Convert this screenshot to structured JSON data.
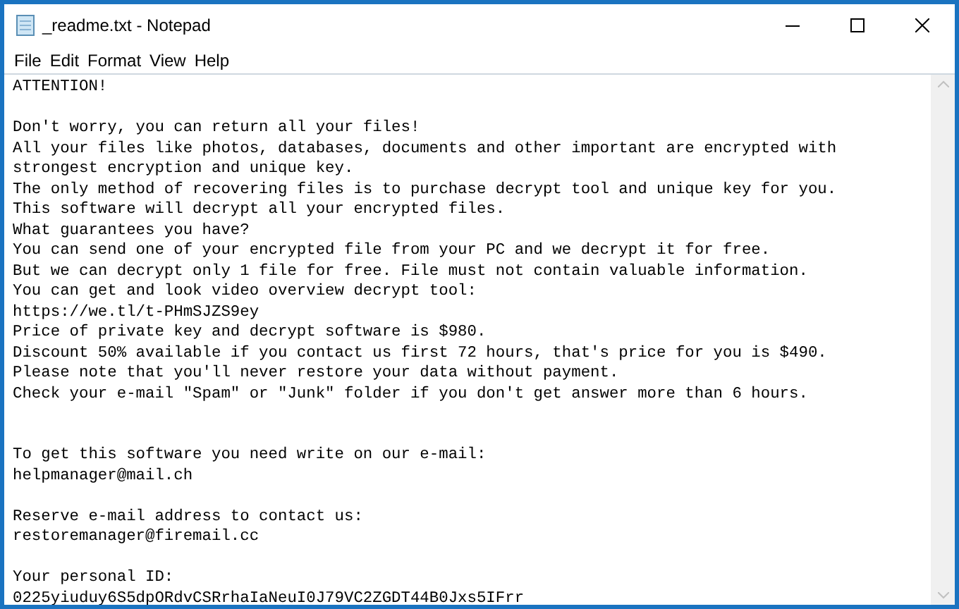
{
  "window": {
    "title": "_readme.txt - Notepad"
  },
  "menu": [
    "File",
    "Edit",
    "Format",
    "View",
    "Help"
  ],
  "document": {
    "text": "ATTENTION!\n\nDon't worry, you can return all your files!\nAll your files like photos, databases, documents and other important are encrypted with strongest encryption and unique key.\nThe only method of recovering files is to purchase decrypt tool and unique key for you.\nThis software will decrypt all your encrypted files.\nWhat guarantees you have?\nYou can send one of your encrypted file from your PC and we decrypt it for free.\nBut we can decrypt only 1 file for free. File must not contain valuable information.\nYou can get and look video overview decrypt tool:\nhttps://we.tl/t-PHmSJZS9ey\nPrice of private key and decrypt software is $980.\nDiscount 50% available if you contact us first 72 hours, that's price for you is $490.\nPlease note that you'll never restore your data without payment.\nCheck your e-mail \"Spam\" or \"Junk\" folder if you don't get answer more than 6 hours.\n\n\nTo get this software you need write on our e-mail:\nhelpmanager@mail.ch\n\nReserve e-mail address to contact us:\nrestoremanager@firemail.cc\n\nYour personal ID:\n0225yiuduy6S5dpORdvCSRrhaIaNeuI0J79VC2ZGDT44B0Jxs5IFrr"
  }
}
